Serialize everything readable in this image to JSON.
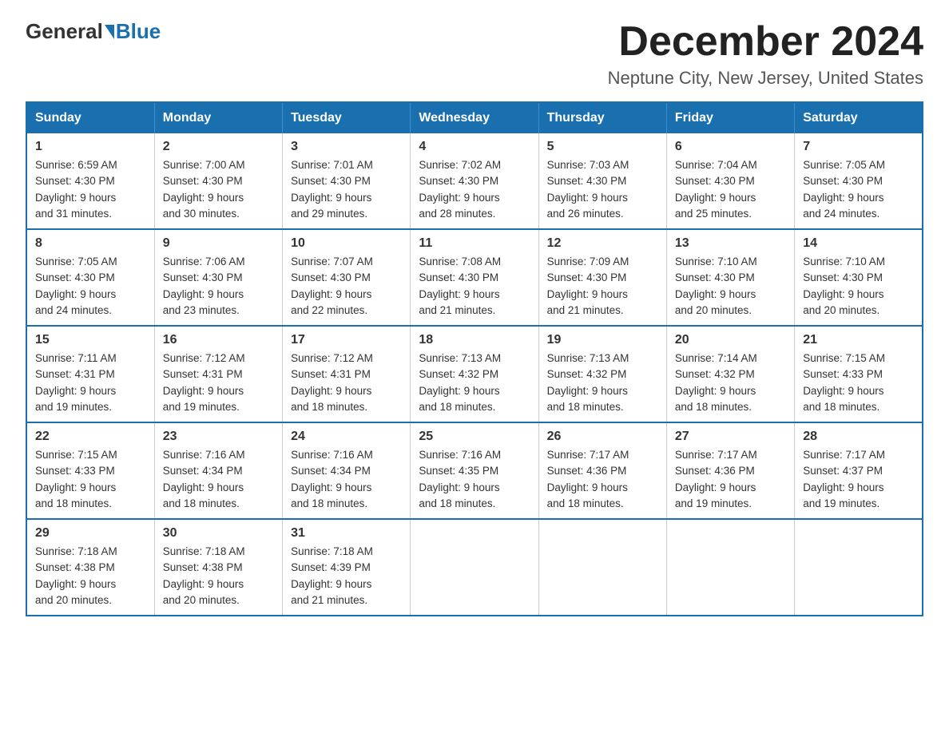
{
  "header": {
    "logo_general": "General",
    "logo_blue": "Blue",
    "month_title": "December 2024",
    "location": "Neptune City, New Jersey, United States"
  },
  "days_of_week": [
    "Sunday",
    "Monday",
    "Tuesday",
    "Wednesday",
    "Thursday",
    "Friday",
    "Saturday"
  ],
  "weeks": [
    [
      {
        "day": "1",
        "sunrise": "6:59 AM",
        "sunset": "4:30 PM",
        "daylight": "9 hours and 31 minutes."
      },
      {
        "day": "2",
        "sunrise": "7:00 AM",
        "sunset": "4:30 PM",
        "daylight": "9 hours and 30 minutes."
      },
      {
        "day": "3",
        "sunrise": "7:01 AM",
        "sunset": "4:30 PM",
        "daylight": "9 hours and 29 minutes."
      },
      {
        "day": "4",
        "sunrise": "7:02 AM",
        "sunset": "4:30 PM",
        "daylight": "9 hours and 28 minutes."
      },
      {
        "day": "5",
        "sunrise": "7:03 AM",
        "sunset": "4:30 PM",
        "daylight": "9 hours and 26 minutes."
      },
      {
        "day": "6",
        "sunrise": "7:04 AM",
        "sunset": "4:30 PM",
        "daylight": "9 hours and 25 minutes."
      },
      {
        "day": "7",
        "sunrise": "7:05 AM",
        "sunset": "4:30 PM",
        "daylight": "9 hours and 24 minutes."
      }
    ],
    [
      {
        "day": "8",
        "sunrise": "7:05 AM",
        "sunset": "4:30 PM",
        "daylight": "9 hours and 24 minutes."
      },
      {
        "day": "9",
        "sunrise": "7:06 AM",
        "sunset": "4:30 PM",
        "daylight": "9 hours and 23 minutes."
      },
      {
        "day": "10",
        "sunrise": "7:07 AM",
        "sunset": "4:30 PM",
        "daylight": "9 hours and 22 minutes."
      },
      {
        "day": "11",
        "sunrise": "7:08 AM",
        "sunset": "4:30 PM",
        "daylight": "9 hours and 21 minutes."
      },
      {
        "day": "12",
        "sunrise": "7:09 AM",
        "sunset": "4:30 PM",
        "daylight": "9 hours and 21 minutes."
      },
      {
        "day": "13",
        "sunrise": "7:10 AM",
        "sunset": "4:30 PM",
        "daylight": "9 hours and 20 minutes."
      },
      {
        "day": "14",
        "sunrise": "7:10 AM",
        "sunset": "4:30 PM",
        "daylight": "9 hours and 20 minutes."
      }
    ],
    [
      {
        "day": "15",
        "sunrise": "7:11 AM",
        "sunset": "4:31 PM",
        "daylight": "9 hours and 19 minutes."
      },
      {
        "day": "16",
        "sunrise": "7:12 AM",
        "sunset": "4:31 PM",
        "daylight": "9 hours and 19 minutes."
      },
      {
        "day": "17",
        "sunrise": "7:12 AM",
        "sunset": "4:31 PM",
        "daylight": "9 hours and 18 minutes."
      },
      {
        "day": "18",
        "sunrise": "7:13 AM",
        "sunset": "4:32 PM",
        "daylight": "9 hours and 18 minutes."
      },
      {
        "day": "19",
        "sunrise": "7:13 AM",
        "sunset": "4:32 PM",
        "daylight": "9 hours and 18 minutes."
      },
      {
        "day": "20",
        "sunrise": "7:14 AM",
        "sunset": "4:32 PM",
        "daylight": "9 hours and 18 minutes."
      },
      {
        "day": "21",
        "sunrise": "7:15 AM",
        "sunset": "4:33 PM",
        "daylight": "9 hours and 18 minutes."
      }
    ],
    [
      {
        "day": "22",
        "sunrise": "7:15 AM",
        "sunset": "4:33 PM",
        "daylight": "9 hours and 18 minutes."
      },
      {
        "day": "23",
        "sunrise": "7:16 AM",
        "sunset": "4:34 PM",
        "daylight": "9 hours and 18 minutes."
      },
      {
        "day": "24",
        "sunrise": "7:16 AM",
        "sunset": "4:34 PM",
        "daylight": "9 hours and 18 minutes."
      },
      {
        "day": "25",
        "sunrise": "7:16 AM",
        "sunset": "4:35 PM",
        "daylight": "9 hours and 18 minutes."
      },
      {
        "day": "26",
        "sunrise": "7:17 AM",
        "sunset": "4:36 PM",
        "daylight": "9 hours and 18 minutes."
      },
      {
        "day": "27",
        "sunrise": "7:17 AM",
        "sunset": "4:36 PM",
        "daylight": "9 hours and 19 minutes."
      },
      {
        "day": "28",
        "sunrise": "7:17 AM",
        "sunset": "4:37 PM",
        "daylight": "9 hours and 19 minutes."
      }
    ],
    [
      {
        "day": "29",
        "sunrise": "7:18 AM",
        "sunset": "4:38 PM",
        "daylight": "9 hours and 20 minutes."
      },
      {
        "day": "30",
        "sunrise": "7:18 AM",
        "sunset": "4:38 PM",
        "daylight": "9 hours and 20 minutes."
      },
      {
        "day": "31",
        "sunrise": "7:18 AM",
        "sunset": "4:39 PM",
        "daylight": "9 hours and 21 minutes."
      },
      null,
      null,
      null,
      null
    ]
  ],
  "labels": {
    "sunrise": "Sunrise:",
    "sunset": "Sunset:",
    "daylight": "Daylight:"
  }
}
